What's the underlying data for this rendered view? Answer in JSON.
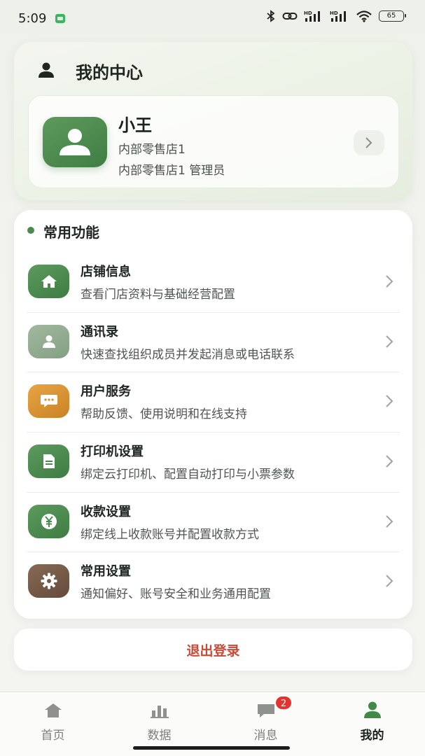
{
  "status_bar": {
    "time": "5:09",
    "battery": "65"
  },
  "header": {
    "title": "我的中心"
  },
  "profile": {
    "name": "小王",
    "store": "内部零售店1",
    "role": "内部零售店1 管理员"
  },
  "functions": {
    "section_title": "常用功能",
    "items": [
      {
        "title": "店铺信息",
        "desc": "查看门店资料与基础经营配置",
        "icon": "home-icon",
        "color": "#4d8a50"
      },
      {
        "title": "通讯录",
        "desc": "快速查找组织成员并发起消息或电话联系",
        "icon": "contact-icon",
        "color": "#8fa98e"
      },
      {
        "title": "用户服务",
        "desc": "帮助反馈、使用说明和在线支持",
        "icon": "chat-bubble-icon",
        "color": "#d98f2f"
      },
      {
        "title": "打印机设置",
        "desc": "绑定云打印机、配置自动打印与小票参数",
        "icon": "document-icon",
        "color": "#4d8a50"
      },
      {
        "title": "收款设置",
        "desc": "绑定线上收款账号并配置收款方式",
        "icon": "yuan-icon",
        "color": "#4d8a50"
      },
      {
        "title": "常用设置",
        "desc": "通知偏好、账号安全和业务通用配置",
        "icon": "gear-icon",
        "color": "#7a5d4a"
      }
    ]
  },
  "logout": {
    "label": "退出登录",
    "color": "#c94a36"
  },
  "nav": {
    "tabs": [
      {
        "label": "首页",
        "icon": "home-icon"
      },
      {
        "label": "数据",
        "icon": "bar-chart-icon"
      },
      {
        "label": "消息",
        "icon": "message-icon",
        "badge": "2"
      },
      {
        "label": "我的",
        "icon": "user-icon",
        "active": true
      }
    ]
  },
  "colors": {
    "accent": "#4d8a50",
    "badge": "#e7312e"
  }
}
